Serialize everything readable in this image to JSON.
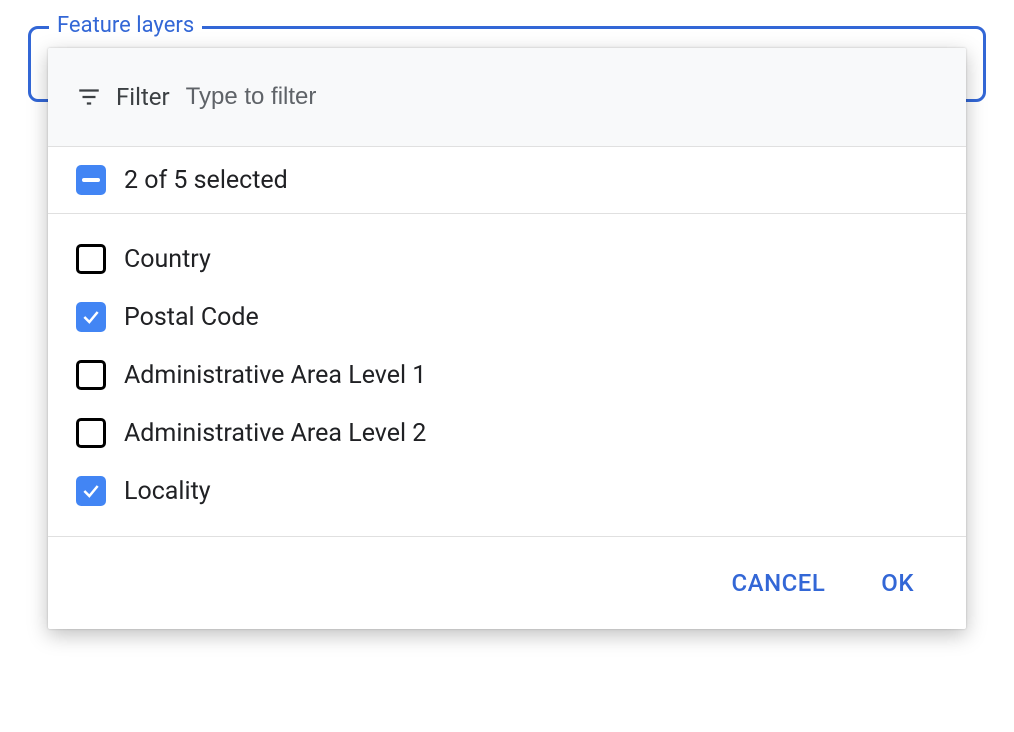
{
  "field": {
    "legend": "Feature layers"
  },
  "filter": {
    "label": "Filter",
    "placeholder": "Type to filter",
    "value": ""
  },
  "summary": {
    "text": "2 of 5 selected"
  },
  "options": [
    {
      "label": "Country",
      "checked": false
    },
    {
      "label": "Postal Code",
      "checked": true
    },
    {
      "label": "Administrative Area Level 1",
      "checked": false
    },
    {
      "label": "Administrative Area Level 2",
      "checked": false
    },
    {
      "label": "Locality",
      "checked": true
    }
  ],
  "actions": {
    "cancel": "CANCEL",
    "ok": "OK"
  },
  "colors": {
    "accent": "#3367d6",
    "checkbox": "#4285f4"
  }
}
